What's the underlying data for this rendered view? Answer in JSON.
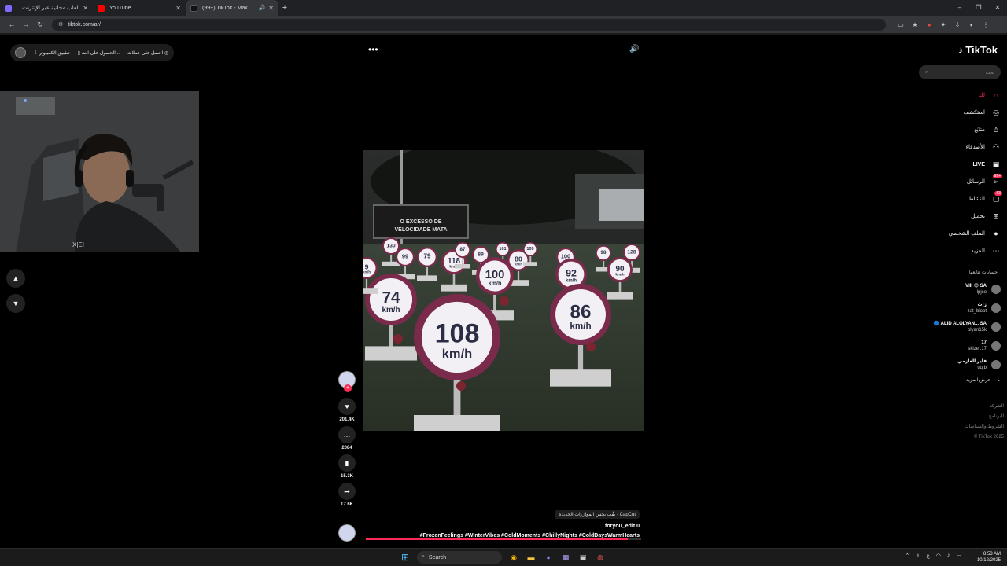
{
  "browser": {
    "tabs": [
      {
        "title": "ألعاب مجانية عبر الإنترنت على ك",
        "color": "#7f6bff",
        "active": false
      },
      {
        "title": "YouTube",
        "color": "#ff0000",
        "active": false
      },
      {
        "title": "(99+) TikTok - Make Your Da",
        "color": "#222222",
        "active": true
      }
    ],
    "new_tab": "+",
    "url": "tiktok.com/ar/",
    "window_controls": [
      "–",
      "❐",
      "✕"
    ]
  },
  "top_buttons": {
    "pc_app": "تطبيق الكمبيوتر",
    "get_app": "الحصول على الت...",
    "coins": "احصل على عملات"
  },
  "caption": {
    "capcut": "CapCut - يقُب بحس الموازرات الجديدة",
    "author": "foryou_edit.0",
    "hashtags": "#FrozenFeelings #WinterVibes #ColdMoments #ChillyNights #ColdDaysWarmHearts"
  },
  "actions": {
    "likes": "201.4K",
    "comments": "2084",
    "saves": "15.3K",
    "shares": "17.6K"
  },
  "progress": 0.95,
  "sidebar": {
    "logo": "TikTok",
    "search_placeholder": "بحث",
    "nav": [
      {
        "label": "لك",
        "icon": "home-icon",
        "glyph": "⌂",
        "active": true
      },
      {
        "label": "استكشف",
        "icon": "compass-icon",
        "glyph": "◎"
      },
      {
        "label": "متابَع",
        "icon": "user-add-icon",
        "glyph": "♙"
      },
      {
        "label": "الأصدقاء",
        "icon": "friends-icon",
        "glyph": "⚇"
      },
      {
        "label": "LIVE",
        "icon": "live-icon",
        "glyph": "▣"
      },
      {
        "label": "الرسائل",
        "icon": "send-icon",
        "glyph": "➢",
        "badge": "99+"
      },
      {
        "label": "النشاط",
        "icon": "activity-icon",
        "glyph": "▢",
        "badge": "63"
      },
      {
        "label": "تحميل",
        "icon": "upload-icon",
        "glyph": "⊞"
      },
      {
        "label": "الملف الشخصي",
        "icon": "profile-avatar-icon",
        "glyph": "●"
      },
      {
        "label": "المزيد",
        "icon": "more-icon",
        "glyph": "⋯"
      }
    ],
    "following_title": "حسابات تتابعها",
    "following": [
      {
        "name": "VIII 😍 SA",
        "handle": "lpjco"
      },
      {
        "name": "زات",
        "handle": "zat_bloot"
      },
      {
        "name": "🔵 ALID ALOLYAN... SA",
        "handle": "olyan15k"
      },
      {
        "name": "17",
        "handle": "skizer.17"
      },
      {
        "name": "فايز العازمي",
        "handle": "uq.b"
      }
    ],
    "see_more": "عرض المزيد",
    "footer": [
      "الشركة",
      "البرنامج",
      "الشروط والسياسات",
      "© TikTok 2025"
    ]
  },
  "video": {
    "banner": "O EXCESSO DE VELOCIDADE MATA",
    "signs": [
      "130",
      "99",
      "79",
      "118",
      "87",
      "89",
      "101",
      "80",
      "100",
      "109",
      "100",
      "98",
      "128",
      "92",
      "90",
      "74",
      "86",
      "108",
      "9"
    ],
    "unit": "km/h"
  },
  "taskbar": {
    "search": "Search",
    "time": "8:53 AM",
    "date": "10/12/2025",
    "lang": "ع"
  }
}
